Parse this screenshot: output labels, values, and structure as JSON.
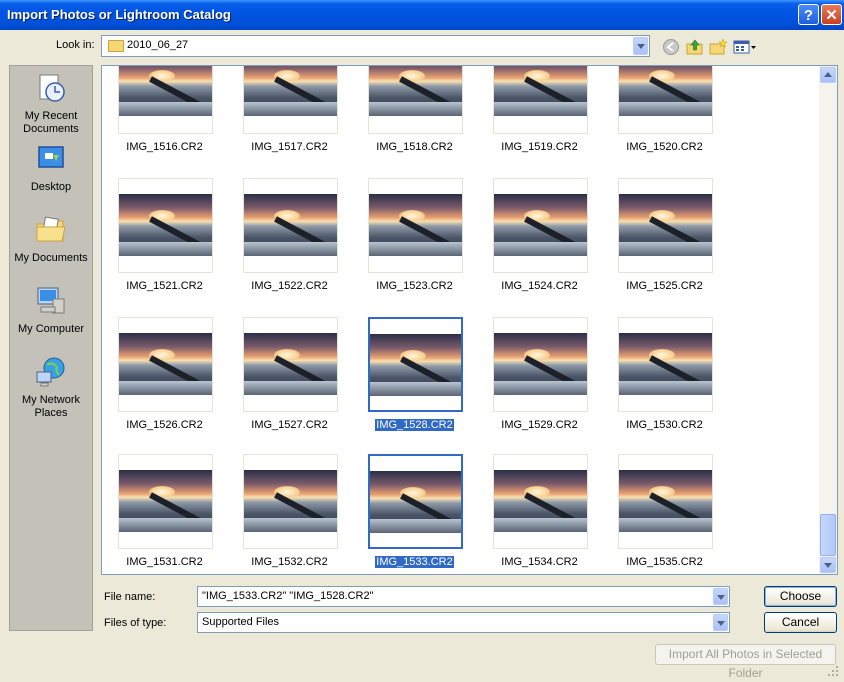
{
  "window": {
    "title": "Import Photos or Lightroom Catalog",
    "help_glyph": "?",
    "close_glyph": "✕"
  },
  "lookin": {
    "label": "Look in:",
    "value": "2010_06_27"
  },
  "places": [
    {
      "label_1": "My Recent",
      "label_2": "Documents",
      "icon": "recent-documents-icon"
    },
    {
      "label_1": "Desktop",
      "label_2": "",
      "icon": "desktop-icon"
    },
    {
      "label_1": "My Documents",
      "label_2": "",
      "icon": "my-documents-icon"
    },
    {
      "label_1": "My Computer",
      "label_2": "",
      "icon": "my-computer-icon"
    },
    {
      "label_1": "My Network",
      "label_2": "Places",
      "icon": "network-places-icon"
    }
  ],
  "files": [
    "IMG_1516.CR2",
    "IMG_1517.CR2",
    "IMG_1518.CR2",
    "IMG_1519.CR2",
    "IMG_1520.CR2",
    "IMG_1521.CR2",
    "IMG_1522.CR2",
    "IMG_1523.CR2",
    "IMG_1524.CR2",
    "IMG_1525.CR2",
    "IMG_1526.CR2",
    "IMG_1527.CR2",
    "IMG_1528.CR2",
    "IMG_1529.CR2",
    "IMG_1530.CR2",
    "IMG_1531.CR2",
    "IMG_1532.CR2",
    "IMG_1533.CR2",
    "IMG_1534.CR2",
    "IMG_1535.CR2"
  ],
  "selected_files": [
    "IMG_1528.CR2",
    "IMG_1533.CR2"
  ],
  "filename": {
    "label": "File name:",
    "value": "\"IMG_1533.CR2\" \"IMG_1528.CR2\""
  },
  "filetype": {
    "label": "Files of type:",
    "value": "Supported Files"
  },
  "buttons": {
    "choose": "Choose",
    "cancel": "Cancel",
    "import_all": "Import All Photos in Selected Folder"
  },
  "colors": {
    "title_blue": "#0054e3",
    "selection": "#316ac5",
    "face": "#ece9d8",
    "places_bg": "#c3c1b8"
  }
}
